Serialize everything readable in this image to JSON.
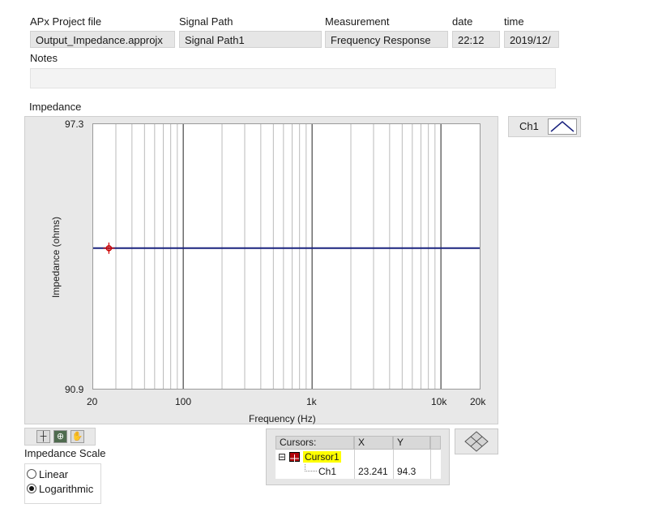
{
  "header": {
    "project_file": {
      "label": "APx Project file",
      "value": "Output_Impedance.approjx"
    },
    "signal_path": {
      "label": "Signal Path",
      "value": "Signal Path1"
    },
    "measurement": {
      "label": "Measurement",
      "value": "Frequency Response"
    },
    "date": {
      "label": "date",
      "value": "22:12"
    },
    "time": {
      "label": "time",
      "value": "2019/12/"
    },
    "notes": {
      "label": "Notes",
      "value": ""
    }
  },
  "graph": {
    "caption": "Impedance",
    "legend": {
      "label": "Ch1",
      "color": "#1a237e"
    }
  },
  "chart_data": {
    "type": "line",
    "title": "Impedance",
    "xlabel": "Frequency (Hz)",
    "ylabel": "Impedance (ohms)",
    "xscale": "log",
    "xlim": [
      20,
      20000
    ],
    "ylim": [
      90.9,
      97.3
    ],
    "x_ticks": [
      "20",
      "100",
      "1k",
      "10k",
      "20k"
    ],
    "y_ticks": [
      "97.3",
      "90.9"
    ],
    "grid": true,
    "series": [
      {
        "name": "Ch1",
        "color": "#1a237e",
        "x": [
          20,
          100,
          1000,
          10000,
          20000
        ],
        "y": [
          94.3,
          94.3,
          94.3,
          94.3,
          94.3
        ]
      }
    ],
    "cursor": {
      "x": 23.241,
      "y": 94.3,
      "color": "#cc0000"
    }
  },
  "palette": {
    "trace": "#1a237e",
    "cursor": "#cc0000",
    "cursor_highlight": "#ffff00"
  },
  "scale": {
    "title": "Impedance Scale",
    "options": [
      {
        "label": "Linear",
        "selected": false
      },
      {
        "label": "Logarithmic",
        "selected": true
      }
    ]
  },
  "cursors_table": {
    "headers": [
      "Cursors:",
      "X",
      "Y"
    ],
    "cursor_name": "Cursor1",
    "collapse_symbol": "⊟",
    "rows": [
      {
        "name": "Ch1",
        "x": "23.241",
        "y": "94.3"
      }
    ]
  },
  "toolbar": {
    "icons": [
      "crosshair-icon",
      "zoom-icon",
      "pan-hand-icon"
    ]
  }
}
